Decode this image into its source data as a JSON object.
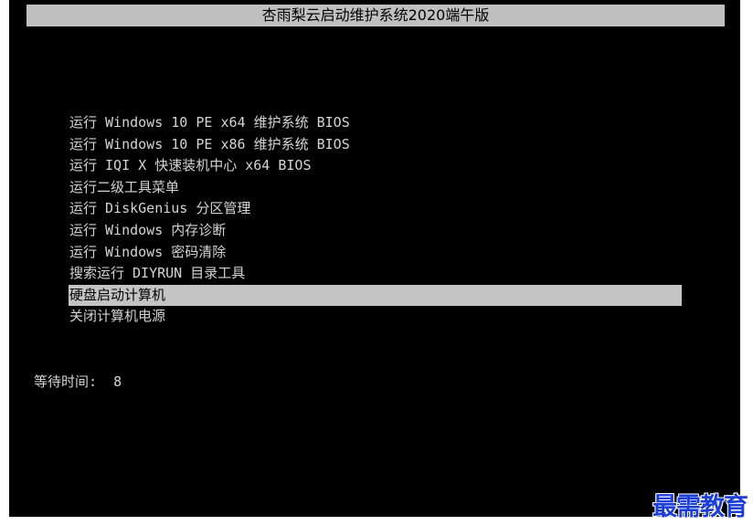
{
  "title": "杏雨梨云启动维护系统2020端午版",
  "menu": {
    "items": [
      {
        "label": "运行 Windows 10 PE x64 维护系统 BIOS"
      },
      {
        "label": "运行 Windows 10 PE x86 维护系统 BIOS"
      },
      {
        "label": "运行 IQI X 快速装机中心 x64 BIOS"
      },
      {
        "label": "运行二级工具菜单"
      },
      {
        "label": "运行 DiskGenius 分区管理"
      },
      {
        "label": "运行 Windows 内存诊断"
      },
      {
        "label": "运行 Windows 密码清除"
      },
      {
        "label": "搜索运行 DIYRUN 目录工具"
      },
      {
        "label": "硬盘启动计算机"
      },
      {
        "label": "关闭计算机电源"
      }
    ],
    "selected_index": 8
  },
  "timer": {
    "label": "等待时间:",
    "value": "8"
  },
  "watermark": "最需教育",
  "colors": {
    "background": "#000000",
    "text": "#d4d4d4",
    "highlight": "#c4c4c4",
    "title_bar": "#c0c0c0",
    "watermark": "#1d3fd6"
  }
}
